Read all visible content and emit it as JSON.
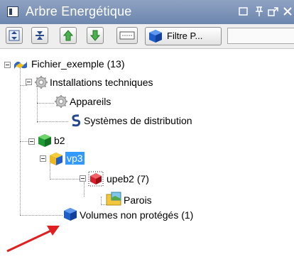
{
  "window": {
    "title": "Arbre Energétique",
    "controls": [
      "□",
      "ᵖ",
      "⇱",
      "✕"
    ]
  },
  "toolbar": {
    "filter_label": "Filtre P...",
    "filter_select_value": ""
  },
  "tree": {
    "nodes": [
      {
        "label": "Fichier_exemple (13)"
      },
      {
        "label": "Installations techniques"
      },
      {
        "label": "Appareils"
      },
      {
        "label": "Systèmes de distribution"
      },
      {
        "label": "b2"
      },
      {
        "label": "vp3"
      },
      {
        "label": "upeb2 (7)"
      },
      {
        "label": "Parois"
      },
      {
        "label": "Volumes non protégés (1)"
      }
    ]
  },
  "colors": {
    "titlebar": "#7b93b8",
    "selection": "#3399ff",
    "annotation_arrow": "#e02020"
  }
}
